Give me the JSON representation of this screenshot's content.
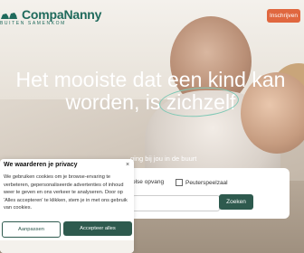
{
  "brand": {
    "name": "CompaNanny",
    "tagline": "BUITEN SAMENKOM"
  },
  "header": {
    "signup_label": "Inschrijven"
  },
  "hero": {
    "headline_line1": "Het mooiste dat een kind kan",
    "headline_line2_prefix": "worden, is ",
    "headline_circled": "zichzelf",
    "subline": "ging bij jou in de buurt"
  },
  "search": {
    "option1": "olse opvang",
    "option2": "Peuterspeelzaal",
    "input_placeholder": "",
    "button_label": "Zoeken"
  },
  "cookie": {
    "title": "We waarderen je privacy",
    "close_label": "×",
    "text": "We gebruiken cookies om je browse-ervaring te verbeteren, gepersonaliseerde advertenties of inhoud weer te geven en ons verkeer te analyseren. Door op 'Alles accepteren' te klikken, stem je in met ons gebruik van cookies.",
    "adjust_label": "Aanpassen",
    "accept_label": "Accepteer alles"
  },
  "colors": {
    "brand_green": "#1f6a5c",
    "accent_orange": "#e0673f",
    "button_dark": "#2e5a4e"
  }
}
